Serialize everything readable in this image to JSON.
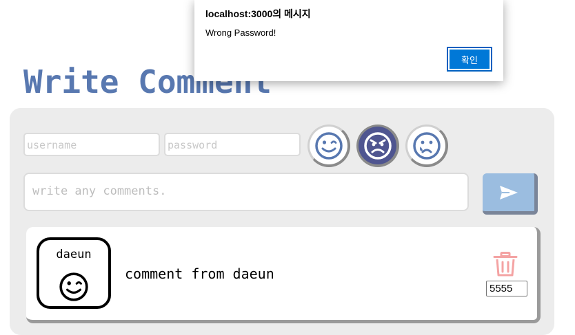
{
  "page": {
    "title": "Write Comment"
  },
  "form": {
    "username_placeholder": "username",
    "password_placeholder": "password",
    "comment_placeholder": "write any comments.",
    "emotions": [
      {
        "name": "wink",
        "selected": false
      },
      {
        "name": "angry",
        "selected": true
      },
      {
        "name": "sad",
        "selected": false
      }
    ],
    "send_icon": "send-icon"
  },
  "comments": [
    {
      "author": "daeun",
      "emotion": "wink",
      "text": "comment from daeun",
      "password_value": "5555",
      "delete_icon": "trash-icon"
    }
  ],
  "dialog": {
    "title": "localhost:3000의 메시지",
    "message": "Wrong Password!",
    "ok_label": "확인"
  },
  "colors": {
    "title": "#5878b0",
    "panel": "#ececec",
    "emoji": "#5878b0",
    "selected_emoji_bg": "#4f5590",
    "send_button": "#9bbde0",
    "trash": "#f4a3a3",
    "dialog_button": "#0078d7"
  }
}
